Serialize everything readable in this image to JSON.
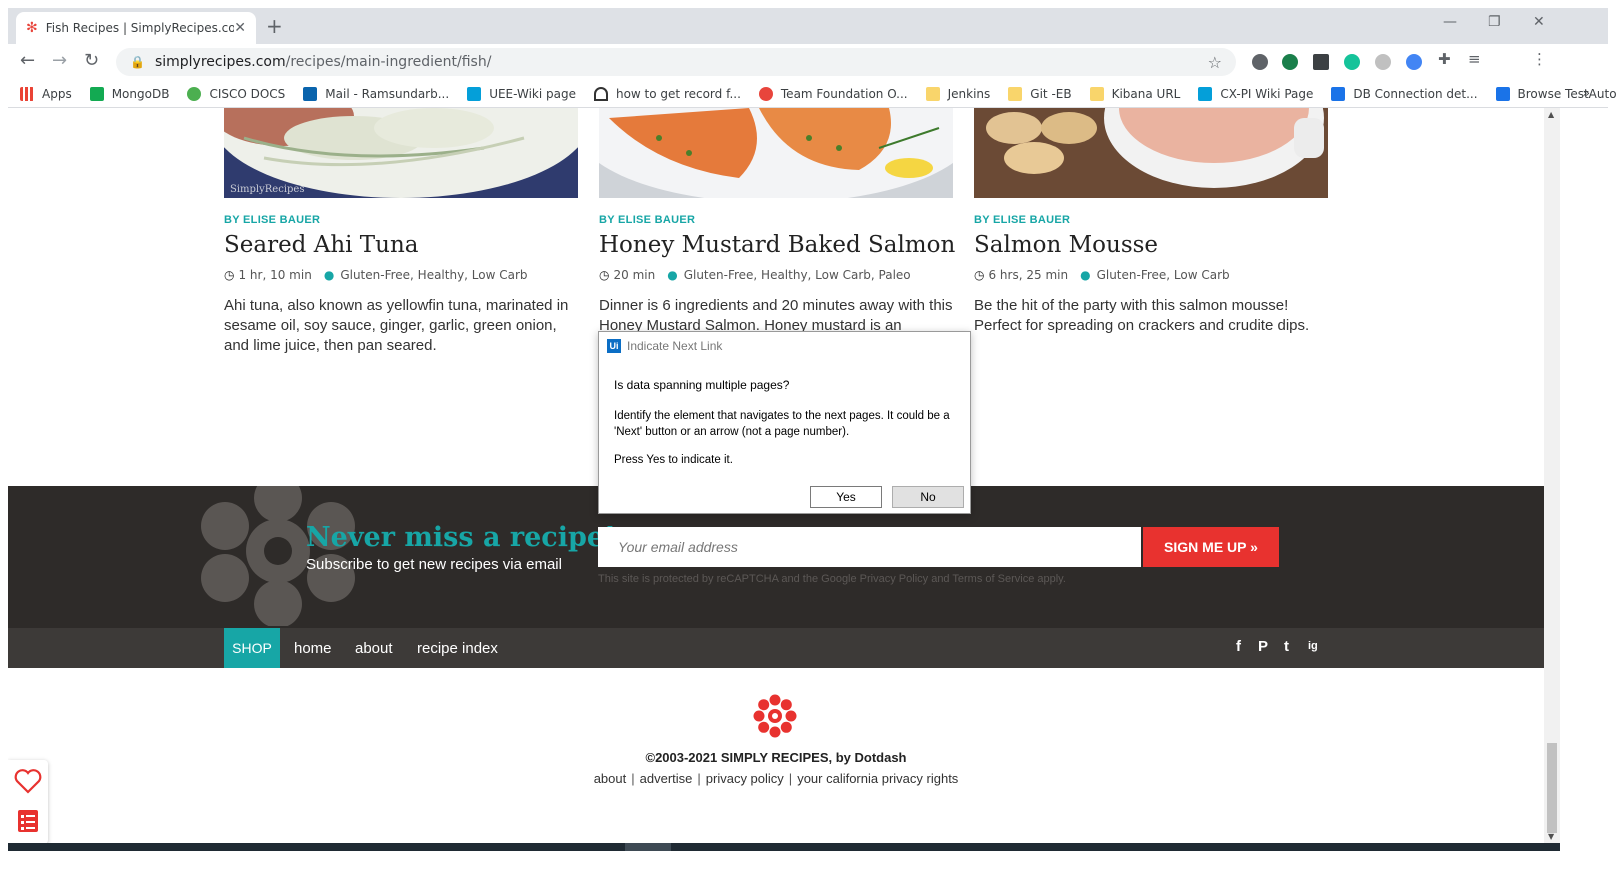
{
  "browser": {
    "tab_title": "Fish Recipes | SimplyRecipes.com",
    "url_host": "simplyrecipes.com",
    "url_path": "/recipes/main-ingredient/fish/",
    "bookmarks": [
      "Apps",
      "MongoDB",
      "CISCO DOCS",
      "Mail - Ramsundarb...",
      "UEE-Wiki page",
      "how to get record f...",
      "Team Foundation O...",
      "Jenkins",
      "Git -EB",
      "Kibana URL",
      "CX-PI Wiki Page",
      "DB Connection det...",
      "Browse TestAutoma..."
    ],
    "bookmarks_more": "»"
  },
  "cards": [
    {
      "author": "BY ELISE BAUER",
      "name": "Seared Ahi Tuna",
      "time": "1 hr, 10 min",
      "tags": "Gluten-Free, Healthy, Low Carb",
      "desc": "Ahi tuna, also known as yellowfin tuna, marinated in sesame oil, soy sauce, ginger, garlic, green onion, and lime juice, then pan seared.",
      "watermark": "SimplyRecipes"
    },
    {
      "author": "BY ELISE BAUER",
      "name": "Honey Mustard Baked Salmon",
      "time": "20 min",
      "tags": "Gluten-Free, Healthy, Low Carb, Paleo",
      "desc": "Dinner is 6 ingredients and 20 minutes away with this Honey Mustard Salmon. Honey mustard is an"
    },
    {
      "author": "BY ELISE BAUER",
      "name": "Salmon Mousse",
      "time": "6 hrs, 25 min",
      "tags": "Gluten-Free, Low Carb",
      "desc": "Be the hit of the party with this salmon mousse! Perfect for spreading on crackers and crudite dips."
    }
  ],
  "subscribe": {
    "title": "Never miss a recipe!",
    "subtitle": "Subscribe to get new recipes via email",
    "email_placeholder": "Your email address",
    "button": "SIGN ME UP »",
    "recaptcha": "This site is protected by reCAPTCHA and the Google Privacy Policy and Terms of Service apply."
  },
  "nav": {
    "shop": "SHOP",
    "home": "home",
    "about": "about",
    "recipe_index": "recipe index",
    "social": [
      "f",
      "P",
      "t",
      "ig"
    ]
  },
  "footer": {
    "copyright": "©2003-2021 SIMPLY RECIPES, by Dotdash",
    "links": [
      "about",
      "advertise",
      "privacy policy",
      "your california privacy rights"
    ]
  },
  "dialog": {
    "title": "Indicate Next Link",
    "question": "Is data spanning multiple pages?",
    "body": "Identify the element that navigates to the next pages. It could be a 'Next' button or an arrow (not a page number).",
    "press": "Press Yes to indicate it.",
    "yes": "Yes",
    "no": "No"
  },
  "colors": {
    "accent_teal": "#17a6a6",
    "signup_red": "#e8322f",
    "band_dark": "#2e2b29",
    "nav_dark": "#3d3a38"
  }
}
